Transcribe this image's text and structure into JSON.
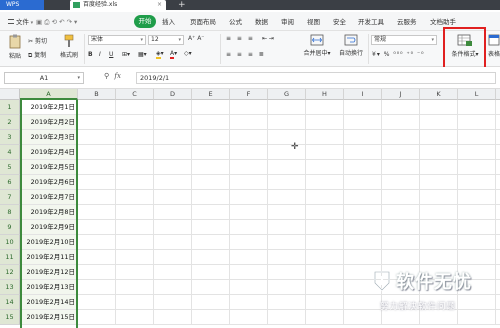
{
  "titlebar": {
    "app_name": "WPS",
    "doc_name": "百度经验.xls",
    "new_tab": "+",
    "close": "×"
  },
  "menu": {
    "file": "文件",
    "start": "开始",
    "items": [
      "插入",
      "页面布局",
      "公式",
      "数据",
      "审阅",
      "视图",
      "安全",
      "开发工具",
      "云服务",
      "文档助手"
    ]
  },
  "ribbon": {
    "cut": "剪切",
    "copy": "复制",
    "format_painter": "格式刷",
    "paste": "粘贴",
    "font_name": "宋体",
    "font_size": "12",
    "merge_center": "合并居中",
    "wrap_text": "自动换行",
    "number_format": "常规",
    "conditional_format": "条件格式",
    "table_style": "表格"
  },
  "formula_bar": {
    "name_box": "A1",
    "fx": "fx",
    "formula": "2019/2/1"
  },
  "columns": [
    "A",
    "B",
    "C",
    "D",
    "E",
    "F",
    "G",
    "H",
    "I",
    "J",
    "K",
    "L"
  ],
  "rows": [
    "1",
    "2",
    "3",
    "4",
    "5",
    "6",
    "7",
    "8",
    "9",
    "10",
    "11",
    "12",
    "13",
    "14",
    "15"
  ],
  "column_a_values": [
    "2019年2月1日",
    "2019年2月2日",
    "2019年2月3日",
    "2019年2月4日",
    "2019年2月5日",
    "2019年2月6日",
    "2019年2月7日",
    "2019年2月8日",
    "2019年2月9日",
    "2019年2月10日",
    "2019年2月11日",
    "2019年2月12日",
    "2019年2月13日",
    "2019年2月14日",
    "2019年2月15日"
  ],
  "watermark": {
    "title": "软件无忧",
    "subtitle": "努力解决软件问题"
  },
  "colors": {
    "start_button": "#1f9d4a",
    "selection": "#3d8a3d",
    "highlight_box": "#e02020"
  }
}
